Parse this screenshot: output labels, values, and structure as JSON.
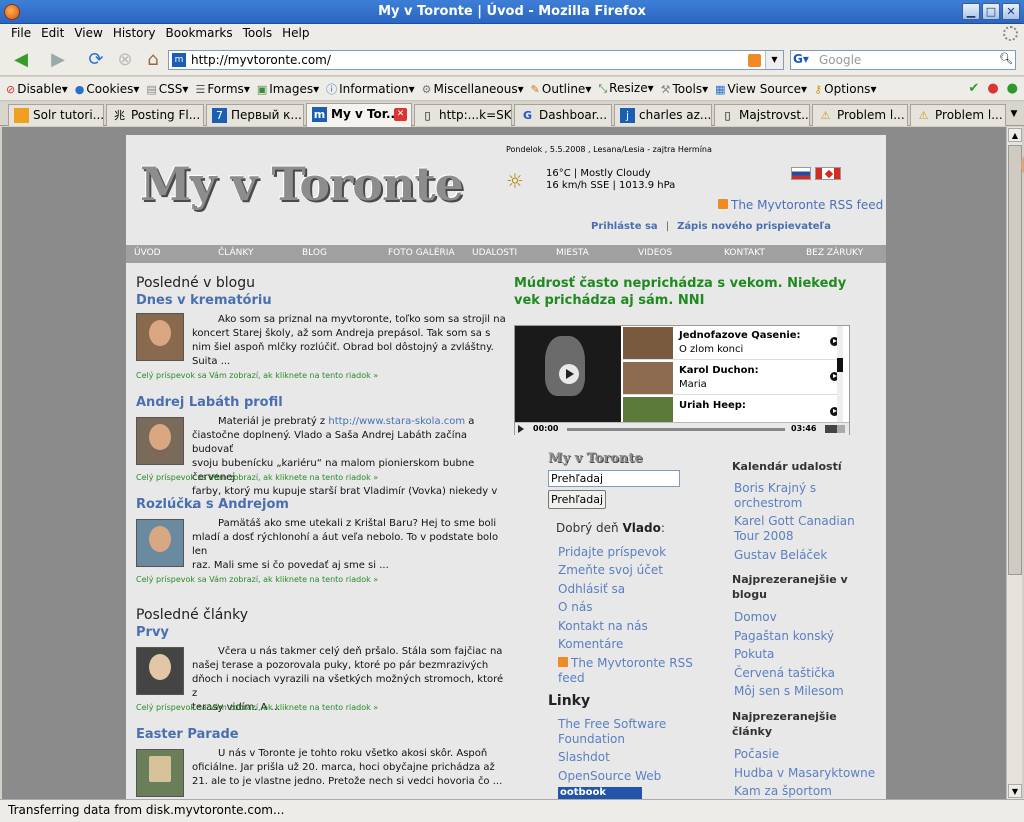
{
  "window": {
    "title": "My v Toronte | Úvod - Mozilla Firefox"
  },
  "menu": [
    "File",
    "Edit",
    "View",
    "History",
    "Bookmarks",
    "Tools",
    "Help"
  ],
  "nav": {
    "url": "http://myvtoronte.com/",
    "search_placeholder": "Google"
  },
  "devbar": [
    "Disable",
    "Cookies",
    "CSS",
    "Forms",
    "Images",
    "Information",
    "Miscellaneous",
    "Outline",
    "Resize",
    "Tools",
    "View Source",
    "Options"
  ],
  "tabs": [
    {
      "label": "Solr tutori..."
    },
    {
      "label": "Posting Fl..."
    },
    {
      "label": "Первый к..."
    },
    {
      "label": "My v Tor..."
    },
    {
      "label": "http:...k=SK"
    },
    {
      "label": "Dashboar..."
    },
    {
      "label": "charles az..."
    },
    {
      "label": "Majstrovst..."
    },
    {
      "label": "Problem l..."
    },
    {
      "label": "Problem l..."
    }
  ],
  "site": {
    "logo": "My v Toronte",
    "dateline": "Pondelok , 5.5.2008 , Lesana/Lesia - zajtra Hermína",
    "weather_line1": "16°C | Mostly Cloudy",
    "weather_line2": "16 km/h SSE | 1013.9 hPa",
    "rss_feed": "The Myvtoronte RSS feed",
    "login": "Prihláste sa",
    "register": "Zápis nového prispievateľa",
    "nav": [
      "ÚVOD",
      "ČLÁNKY",
      "BLOG",
      "FOTO GALÉRIA",
      "UDALOSTI",
      "MIESTA",
      "VIDEOS",
      "KONTAKT",
      "BEZ ZÁRUKY"
    ]
  },
  "left": {
    "blog_heading": "Posledné v blogu",
    "articles_heading": "Posledné články",
    "readmore": "Celý príspevok sa Vám zobrazí, ak kliknete na tento riadok »",
    "posts": [
      {
        "title": "Dnes v krematóriu",
        "l1": "Ako som sa priznal na myvtoronte, toľko som sa strojil na",
        "l2": "koncert Starej školy, až som Andreja prepásol. Tak som sa s",
        "l3": "nim šiel aspoň mlčky rozlúčiť. Obrad bol dôstojný a zvláštny.",
        "l4": "Suita ..."
      },
      {
        "title": "Andrej Labáth profil",
        "l1a": "Materiál je prebratý z",
        "link": "http://www.stara-skola.com",
        "l1b": "a",
        "l2": "čiastočne doplnený. Vlado a Saša Andrej Labáth začína budovať",
        "l3": "svoju bubenícku „kariéru“ na malom pionierskom bubne červenej",
        "l4": "farby, ktorý mu kupuje starší brat Vladimír (Vovka) niekedy v ..."
      },
      {
        "title": "Rozlúčka s Andrejom",
        "l1": "Pamätáš ako sme utekali z Krištal Baru? Hej to sme boli",
        "l2": "mladí a dosť rýchlonohí a áut veľa nebolo. To v podstate bolo len",
        "l3": "raz. Mali sme si čo povedať aj sme si ..."
      },
      {
        "title": "Prvy",
        "l1": "Včera u nás takmer celý deň pršalo. Stála som fajčiac na",
        "l2": "našej terase a pozorovala puky, ktoré po pár bezmrazivých",
        "l3": "dňoch i nociach vyrazili na všetkých možných stromoch, ktoré z",
        "l4": "terasy vidím. A ..."
      },
      {
        "title": "Easter Parade",
        "l1": "U nás v Toronte je tohto roku všetko akosi skôr. Aspoň",
        "l2": "oficiálne. Jar prišla už 20. marca, hoci obyčajne prichádza až",
        "l3": "21. ale to je vlastne jedno. Pretože nech si vedci hovoria čo ..."
      }
    ]
  },
  "quote": "Múdrosť často neprichádza s vekom. Niekedy vek prichádza aj sám. NNI",
  "player": {
    "items": [
      {
        "name": "Jednofazove Qasenie:",
        "sub": "O zlom konci"
      },
      {
        "name": "Karol Duchon:",
        "sub": "Maria"
      },
      {
        "name": "Uriah Heep:",
        "sub": ""
      }
    ],
    "time_start": "00:00",
    "time_end": "03:46"
  },
  "middle": {
    "mini_logo": "My v Toronte",
    "search_value": "Prehľadaj",
    "search_button": "Prehľadaj",
    "greet_prefix": "Dobrý deň",
    "greet_name": "Vlado",
    "links": [
      "Pridajte príspevok",
      "Zmeňte svoj účet",
      "Odhlásiť sa",
      "O nás",
      "Kontakt na nás",
      "Komentáre"
    ],
    "rss1": "The Myvtoronte RSS",
    "rss2": "feed",
    "linky_heading": "Linky",
    "linky": [
      "The Free Software",
      "Foundation",
      "Slashdot",
      "OpenSource Web"
    ],
    "ootbook": "ootbook"
  },
  "right": {
    "calendar_heading": "Kalendár udalostí",
    "calendar": [
      "Boris Krajný s",
      "orchestrom",
      "Karel Gott Canadian",
      "Tour 2008",
      "Gustav Beláček"
    ],
    "blog_heading_1": "Najprezeranejšie v",
    "blog_heading_2": "blogu",
    "blog": [
      "Domov",
      "Pagaštan konský",
      "Pokuta",
      "Červená taštička",
      "Môj sen s Milesom"
    ],
    "articles_heading_1": "Najprezeranejšie",
    "articles_heading_2": "články",
    "articles": [
      "Počasie",
      "Hudba v Masarykto­wne",
      "Kam za športom"
    ]
  },
  "status": "Transferring data from disk.myvtoronte.com..."
}
